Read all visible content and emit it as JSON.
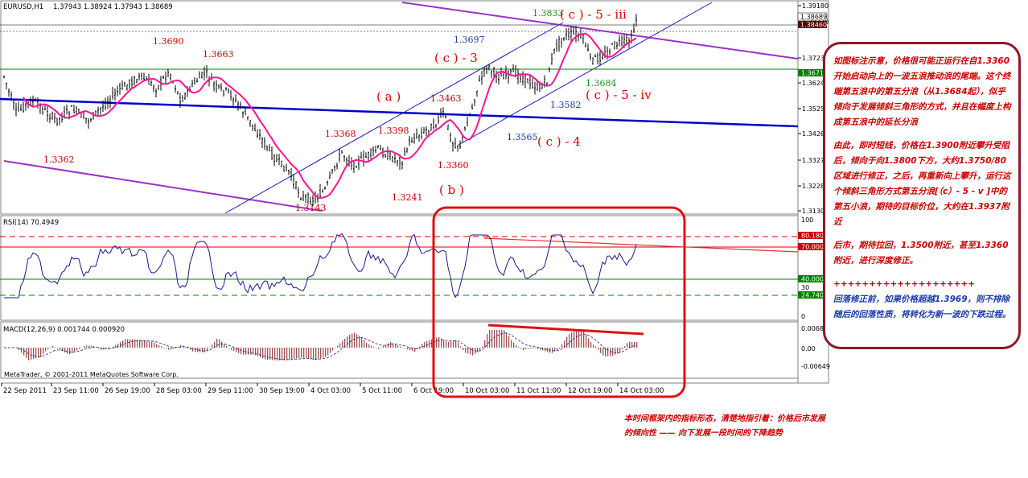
{
  "header": {
    "symbol": "EURUSD,H1",
    "ohlc": "1.37943 1.38924 1.37943 1.38689"
  },
  "price_axis": {
    "ticks": [
      "1.39180",
      "1.38220",
      "1.37230",
      "1.36240",
      "1.35250",
      "1.34260",
      "1.33270",
      "1.32280",
      "1.31300"
    ],
    "current_price": "1.38689",
    "bid_tag": "1.38460",
    "level_tag": "1.3671"
  },
  "wave_labels": {
    "l_1_3690": "1.3690",
    "l_1_3663": "1.3663",
    "l_1_3362": "1.3362",
    "l_1_3143": "1.3143",
    "l_1_3368": "1.3368",
    "l_1_3398": "1.3398",
    "l_1_3241": "1.3241",
    "l_1_3463": "1.3463",
    "l_1_3360": "1.3360",
    "l_1_3697": "1.3697",
    "l_1_3833": "1.3833",
    "l_1_3684": "1.3684",
    "l_1_3582": "1.3582",
    "l_1_3565": "1.3565",
    "wave_a": "( a )",
    "wave_b": "( b )",
    "wave_c3": "( c ) - 3",
    "wave_c4": "( c ) - 4",
    "wave_c5iii": "( c ) - 5 - iii",
    "wave_c5iv": "( c ) - 5 - iv"
  },
  "rsi": {
    "label": "RSI(14) 70.4949",
    "ticks": [
      "100",
      "30",
      "0"
    ],
    "tags": [
      "80.1800",
      "70.0000",
      "40.0000",
      "24.7400"
    ]
  },
  "macd": {
    "label": "MACD(12,26,9) 0.001744 0.000920",
    "ticks": [
      "0.00680",
      "0.00",
      "-0.00649"
    ]
  },
  "copyright": "MetaTrader, © 2001-2011 MetaQuotes Software Corp.",
  "time_axis": [
    "22 Sep 2011",
    "23 Sep 11:00",
    "26 Sep 19:00",
    "28 Sep 03:00",
    "29 Sep 11:00",
    "30 Sep 19:00",
    "4 Oct 03:00",
    "5 Oct 11:00",
    "6 Oct 19:00",
    "10 Oct 03:00",
    "11 Oct 11:00",
    "12 Oct 19:00",
    "14 Oct 03:00"
  ],
  "notes": {
    "p1": "如图标注示意，价格很可能正运行在自1.3360开始启动向上的一波五浪推动浪的尾端。这个终端第五浪中的第五分浪（从1.3684起），似乎倾向于发展倾斜三角形的方式，并且在幅度上构成第五浪中的延长分浪",
    "p2": "由此，即时短线，价格在1.3900附近攀升受阻后，倾向于向1.3800下方，大约1.3750/80区域进行修正，之后，再重新向上攀升，运行这个倾斜三角形方式第五分浪[（c）- 5 - v ]中的第五小浪，期待的目标价位，大约在1.3937附近",
    "p3": "后市，期待拉回，1.3500附近，甚至1.3360附近，进行深度修正。",
    "plus": "++++++++++++++++++++",
    "p4": "回落修正前，如果价格超越1.3969，则不排除随后的回落性质，将转化为新一波的下跌过程。"
  },
  "bottom_note": "本时间框架内的指标形态，清楚地指引着：价格后市发展的倾向性 —— 向下发展一段时间的下降趋势",
  "colors": {
    "channel_purple": "#9933cc",
    "trend_blue": "#0000cc",
    "ma_magenta": "#ff1493",
    "level_green": "#008000",
    "annot_red": "#dd0000",
    "label_darkred": "#cc0000",
    "label_blue": "#1a3aa8",
    "label_green": "#228b22"
  },
  "chart_data": [
    {
      "type": "line",
      "title": "EURUSD,H1",
      "pivots": [
        {
          "label": "1.3362",
          "value": 1.3362
        },
        {
          "label": "1.3690",
          "value": 1.369
        },
        {
          "label": "1.3663",
          "value": 1.3663
        },
        {
          "label": "1.3143",
          "value": 1.3143
        },
        {
          "label": "1.3368",
          "value": 1.3368
        },
        {
          "label": "1.3241",
          "value": 1.3241
        },
        {
          "label": "1.3398",
          "value": 1.3398
        },
        {
          "label": "1.3463",
          "value": 1.3463
        },
        {
          "label": "1.3360",
          "value": 1.336
        },
        {
          "label": "1.3697",
          "value": 1.3697
        },
        {
          "label": "1.3565",
          "value": 1.3565
        },
        {
          "label": "1.3833",
          "value": 1.3833
        },
        {
          "label": "1.3582",
          "value": 1.3582
        },
        {
          "label": "1.3684",
          "value": 1.3684
        },
        {
          "label": "1.38689",
          "value": 1.38689
        }
      ],
      "ylim": [
        1.313,
        1.3918
      ]
    },
    {
      "type": "line",
      "title": "RSI(14) 70.4949",
      "levels": [
        80.18,
        70.0,
        40.0,
        24.74
      ],
      "ylim": [
        0,
        100
      ]
    },
    {
      "type": "bar",
      "title": "MACD(12,26,9) 0.001744 0.000920",
      "ylim": [
        -0.00649,
        0.0068
      ]
    }
  ]
}
